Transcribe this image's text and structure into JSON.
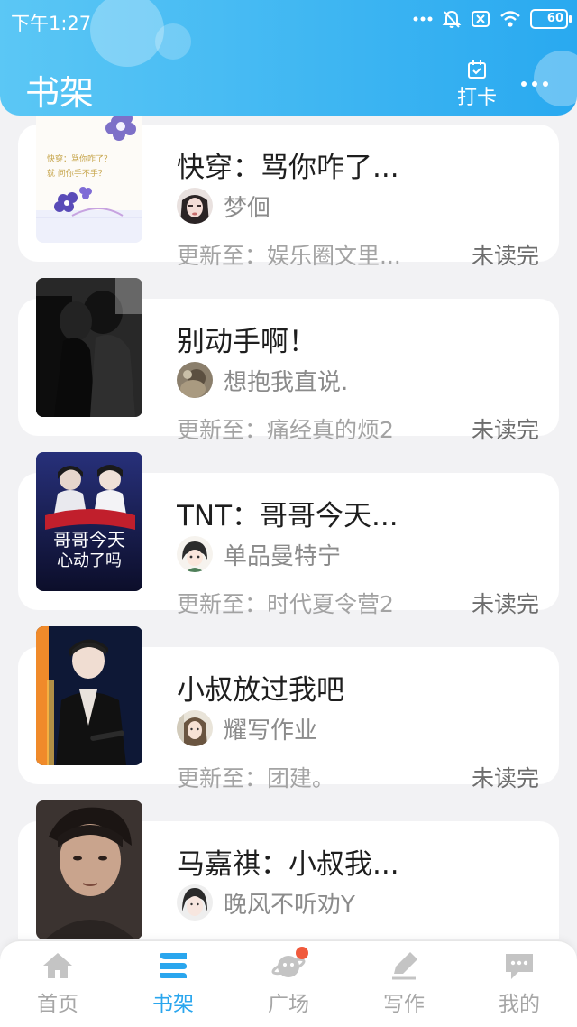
{
  "status_bar": {
    "time": "下午1:27",
    "battery": "60"
  },
  "header": {
    "title": "书架",
    "checkin_label": "打卡"
  },
  "books": [
    {
      "title": "快穿：骂你咋了...",
      "author": "梦佪",
      "update": "更新至：娱乐圈文里...",
      "status": "未读完"
    },
    {
      "title": "别动手啊！",
      "author": "想抱我直说.",
      "update": "更新至：痛经真的烦2",
      "status": "未读完"
    },
    {
      "title": "TNT：哥哥今天...",
      "author": "单品曼特宁",
      "update": "更新至：时代夏令营2",
      "status": "未读完"
    },
    {
      "title": "小叔放过我吧",
      "author": "耀写作业",
      "update": "更新至：团建。",
      "status": "未读完"
    },
    {
      "title": "马嘉祺：小叔我...",
      "author": "晚风不听劝Y",
      "update": "",
      "status": ""
    }
  ],
  "cover_texts": {
    "cover1_line1": "快穿：骂你咋了？",
    "cover1_line2": "就 问你手不手？",
    "cover3_title": "哥哥今天",
    "cover3_sub": "心动了吗"
  },
  "nav": {
    "items": [
      {
        "label": "首页",
        "icon": "home-icon"
      },
      {
        "label": "书架",
        "icon": "bookshelf-icon"
      },
      {
        "label": "广场",
        "icon": "planet-icon"
      },
      {
        "label": "写作",
        "icon": "pen-icon"
      },
      {
        "label": "我的",
        "icon": "chat-icon"
      }
    ],
    "active_index": 1
  },
  "colors": {
    "header_start": "#5bc7f5",
    "header_end": "#29a9f0",
    "accent": "#2aa6ee",
    "badge": "#f05a3c"
  }
}
